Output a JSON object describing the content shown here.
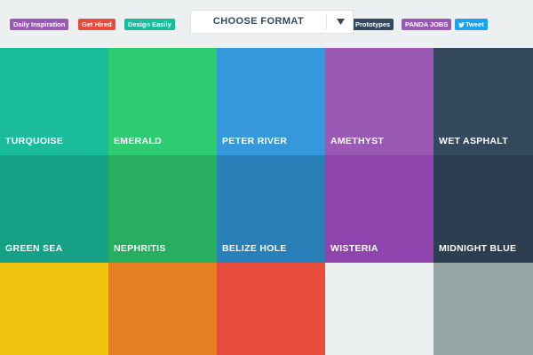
{
  "topbar": {
    "badges": [
      {
        "label": "Daily Inspiration",
        "color": "#9b59b6"
      },
      {
        "label": "Get Hired",
        "color": "#e74c3c"
      },
      {
        "label": "Design Easily",
        "color": "#1abc9c"
      },
      {
        "label": "Prototypes",
        "color": "#34495e"
      },
      {
        "label": "PANDA JOBS",
        "color": "#9b59b6"
      },
      {
        "label": "Tweet",
        "color": "#1da1f2"
      }
    ],
    "format_select": {
      "label": "CHOOSE FORMAT"
    }
  },
  "swatches": [
    {
      "name": "TURQUOISE",
      "color": "#1abc9c"
    },
    {
      "name": "EMERALD",
      "color": "#2ecc71"
    },
    {
      "name": "PETER RIVER",
      "color": "#3498db"
    },
    {
      "name": "AMETHYST",
      "color": "#9b59b6"
    },
    {
      "name": "WET ASPHALT",
      "color": "#34495e"
    },
    {
      "name": "GREEN SEA",
      "color": "#16a085"
    },
    {
      "name": "NEPHRITIS",
      "color": "#27ae60"
    },
    {
      "name": "BELIZE HOLE",
      "color": "#2980b9"
    },
    {
      "name": "WISTERIA",
      "color": "#8e44ad"
    },
    {
      "name": "MIDNIGHT BLUE",
      "color": "#2c3e50"
    },
    {
      "name": "",
      "color": "#f1c40f"
    },
    {
      "name": "",
      "color": "#e67e22"
    },
    {
      "name": "",
      "color": "#e74c3c"
    },
    {
      "name": "",
      "color": "#ecf0f1"
    },
    {
      "name": "",
      "color": "#95a5a6"
    }
  ]
}
